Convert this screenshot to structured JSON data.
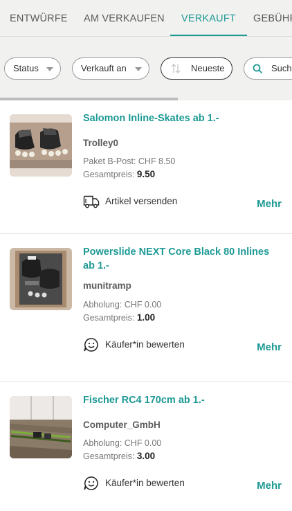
{
  "tabs": [
    {
      "label": "ENTWÜRFE"
    },
    {
      "label": "AM VERKAUFEN"
    },
    {
      "label": "VERKAUFT"
    },
    {
      "label": "GEBÜHREN"
    }
  ],
  "filters": {
    "status_label": "Status",
    "sold_on_label": "Verkauft an",
    "sort_label": "Neueste",
    "search_placeholder": "Suchen"
  },
  "list_progress": 0.61,
  "items": [
    {
      "title": "Salomon Inline-Skates ab 1.-",
      "seller": "Trolley0",
      "shipping": "Paket B-Post: CHF 8.50",
      "total_label": "Gesamtpreis:",
      "total_value": "9.50",
      "action_label": "Artikel versenden",
      "action_icon": "truck-icon",
      "more_label": "Mehr"
    },
    {
      "title": "Powerslide NEXT Core Black 80 Inlines ab 1.-",
      "seller": "munitramp",
      "shipping": "Abholung: CHF 0.00",
      "total_label": "Gesamtpreis:",
      "total_value": "1.00",
      "action_label": "Käufer*in bewerten",
      "action_icon": "smiley-icon",
      "more_label": "Mehr"
    },
    {
      "title": "Fischer RC4 170cm ab 1.-",
      "seller": "Computer_GmbH",
      "shipping": "Abholung: CHF 0.00",
      "total_label": "Gesamtpreis:",
      "total_value": "3.00",
      "action_label": "Käufer*in bewerten",
      "action_icon": "smiley-icon",
      "more_label": "Mehr"
    }
  ],
  "colors": {
    "accent": "#1e9a95",
    "background_bar": "#f1f1ef"
  }
}
